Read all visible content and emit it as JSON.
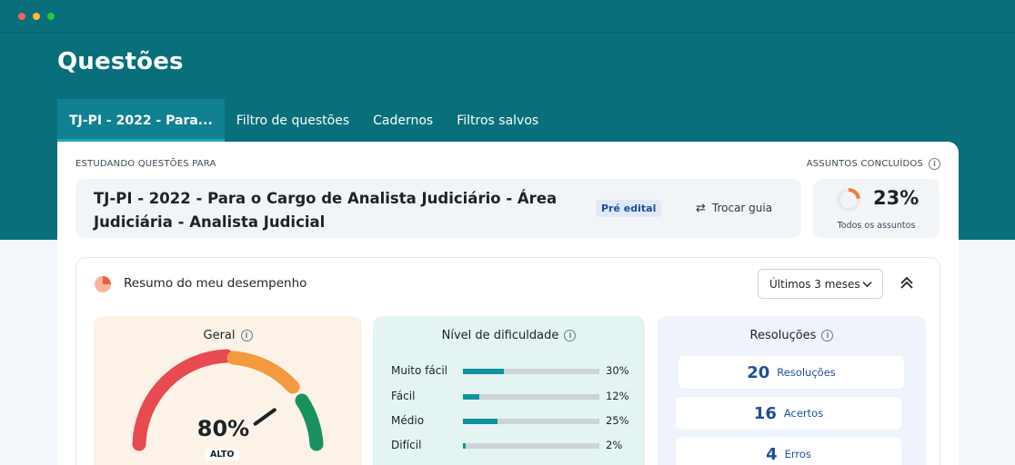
{
  "header": {
    "title": "Questões",
    "tabs": [
      {
        "label": "TJ-PI - 2022 - Para...",
        "active": true
      },
      {
        "label": "Filtro de questões",
        "active": false
      },
      {
        "label": "Cadernos",
        "active": false
      },
      {
        "label": "Filtros salvos",
        "active": false
      }
    ]
  },
  "study": {
    "label": "ESTUDANDO QUESTÕES PARA",
    "guide_title": "TJ-PI - 2022 - Para o Cargo de Analista Judiciário - Área Judiciária - Analista Judicial",
    "badge": "Pré edital",
    "swap_label": "Trocar guia",
    "swap_icon": "swap-arrows-icon"
  },
  "subjects": {
    "label": "ASSUNTOS CONCLUÍDOS",
    "percent_text": "23%",
    "percent_value": 0.23,
    "caption": "Todos os assuntos"
  },
  "performance": {
    "title": "Resumo do meu desempenho",
    "period": "Últimos 3 meses",
    "geral": {
      "title": "Geral",
      "value_text": "80%",
      "value": 0.8,
      "level": "ALTO",
      "colors": [
        "#e84a4f",
        "#f08a3a",
        "#f5b82e",
        "#17925f"
      ]
    },
    "difficulty": {
      "title": "Nível de dificuldade",
      "rows": [
        {
          "label": "Muito fácil",
          "pct_text": "30%",
          "value": 0.3
        },
        {
          "label": "Fácil",
          "pct_text": "12%",
          "value": 0.12
        },
        {
          "label": "Médio",
          "pct_text": "25%",
          "value": 0.25
        },
        {
          "label": "Difícil",
          "pct_text": "2%",
          "value": 0.02
        }
      ]
    },
    "resolutions": {
      "title": "Resoluções",
      "cards": [
        {
          "number": "20",
          "label": "Resoluções"
        },
        {
          "number": "16",
          "label": "Acertos"
        },
        {
          "number": "4",
          "label": "Erros"
        }
      ]
    }
  }
}
